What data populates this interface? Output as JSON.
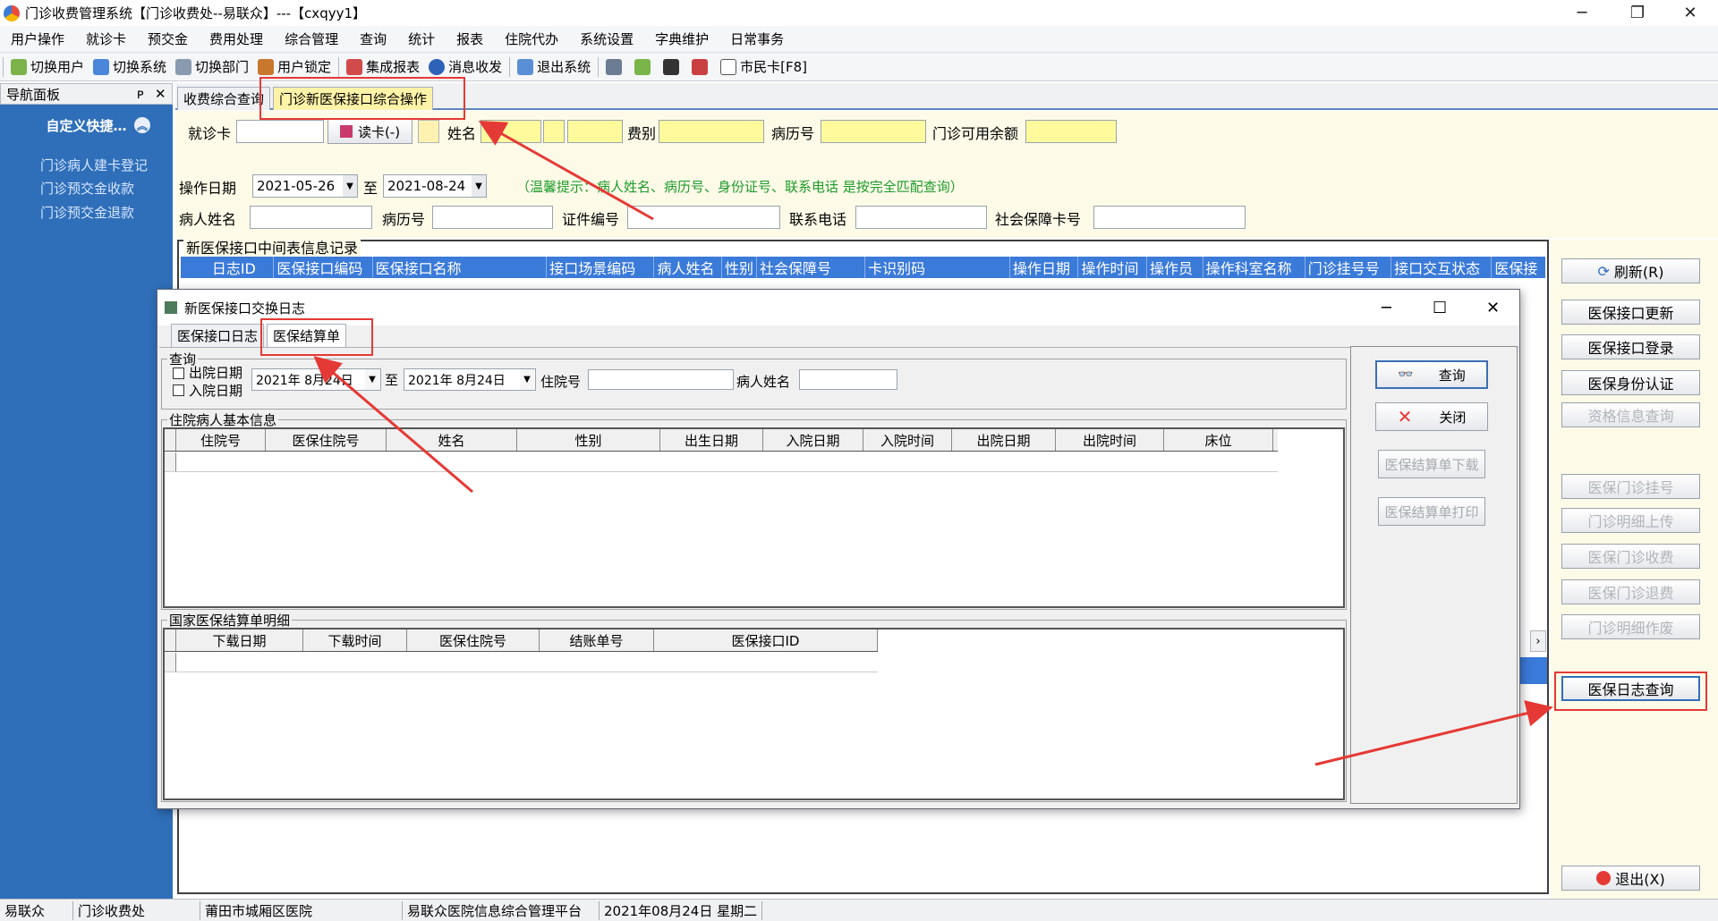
{
  "window": {
    "title": "门诊收费管理系统【门诊收费处--易联众】---【cxqyy1】",
    "controls": [
      "─",
      "❐",
      "✕"
    ]
  },
  "menu": [
    "用户操作",
    "就诊卡",
    "预交金",
    "费用处理",
    "综合管理",
    "查询",
    "统计",
    "报表",
    "住院代办",
    "系统设置",
    "字典维护",
    "日常事务"
  ],
  "toolbar": {
    "items": [
      "切换用户",
      "切换系统",
      "切换部门",
      "用户锁定",
      "集成报表",
      "消息收发",
      "退出系统"
    ],
    "citizen_card": "市民卡[F8]"
  },
  "nav": {
    "header": "导航面板",
    "pin": "ᴘ",
    "close": "✕",
    "section": "自定义快捷…",
    "items": [
      "门诊病人建卡登记",
      "门诊预交金收款",
      "门诊预交金退款"
    ]
  },
  "tabs": [
    "收费综合查询",
    "门诊新医保接口综合操作"
  ],
  "query": {
    "card_label": "就诊卡",
    "read_card": "读卡(-)",
    "name_label": "姓名",
    "fee_label": "费别",
    "record_no_label": "病历号",
    "balance_label": "门诊可用余额",
    "op_date_label": "操作日期",
    "date_from": "2021-05-26",
    "to_label": "至",
    "date_to": "2021-08-24",
    "hint": "（温馨提示：病人姓名、病历号、身份证号、联系电话 是按完全匹配查询）",
    "patient_name_label": "病人姓名",
    "record_no2_label": "病历号",
    "id_no_label": "证件编号",
    "phone_label": "联系电话",
    "ss_card_label": "社会保障卡号"
  },
  "grid": {
    "title": "新医保接口中间表信息记录",
    "columns": [
      "日志ID",
      "医保接口编码",
      "医保接口名称",
      "接口场景编码",
      "病人姓名",
      "性别",
      "社会保障号",
      "卡识别码",
      "操作日期",
      "操作时间",
      "操作员",
      "操作科室名称",
      "门诊挂号号",
      "接口交互状态",
      "医保接"
    ]
  },
  "right_buttons": {
    "refresh": "刷新(R)",
    "update": "医保接口更新",
    "login": "医保接口登录",
    "identity": "医保身份认证",
    "qualification": "资格信息查询",
    "register": "医保门诊挂号",
    "upload": "门诊明细上传",
    "charge": "医保门诊收费",
    "refund": "医保门诊退费",
    "void": "门诊明细作废",
    "log_query": "医保日志查询",
    "exit": "退出(X)"
  },
  "dialog": {
    "title": "新医保接口交换日志",
    "tabs": [
      "医保接口日志",
      "医保结算单"
    ],
    "query_group": "查询",
    "discharge_date": "出院日期",
    "admit_date": "入院日期",
    "date_from": "2021年 8月24日",
    "to_label": "至",
    "date_to": "2021年 8月24日",
    "inpatient_no_label": "住院号",
    "patient_name_label": "病人姓名",
    "basic_group": "住院病人基本信息",
    "basic_columns": [
      "住院号",
      "医保住院号",
      "姓名",
      "性别",
      "出生日期",
      "入院日期",
      "入院时间",
      "出院日期",
      "出院时间",
      "床位"
    ],
    "detail_group": "国家医保结算单明细",
    "detail_columns": [
      "下载日期",
      "下载时间",
      "医保住院号",
      "结账单号",
      "医保接口ID"
    ],
    "buttons": {
      "query": "查询",
      "close": "关闭",
      "download": "医保结算单下载",
      "print": "医保结算单打印"
    }
  },
  "statusbar": [
    "易联众",
    "门诊收费处",
    "莆田市城厢区医院",
    "易联众医院信息综合管理平台",
    "2021年08月24日 星期二"
  ],
  "colors": {
    "nav_blue": "#2f6fb9",
    "grid_header_blue": "#3a7ad9",
    "highlight_red": "#e53935",
    "input_yellow": "#fffb9c"
  }
}
